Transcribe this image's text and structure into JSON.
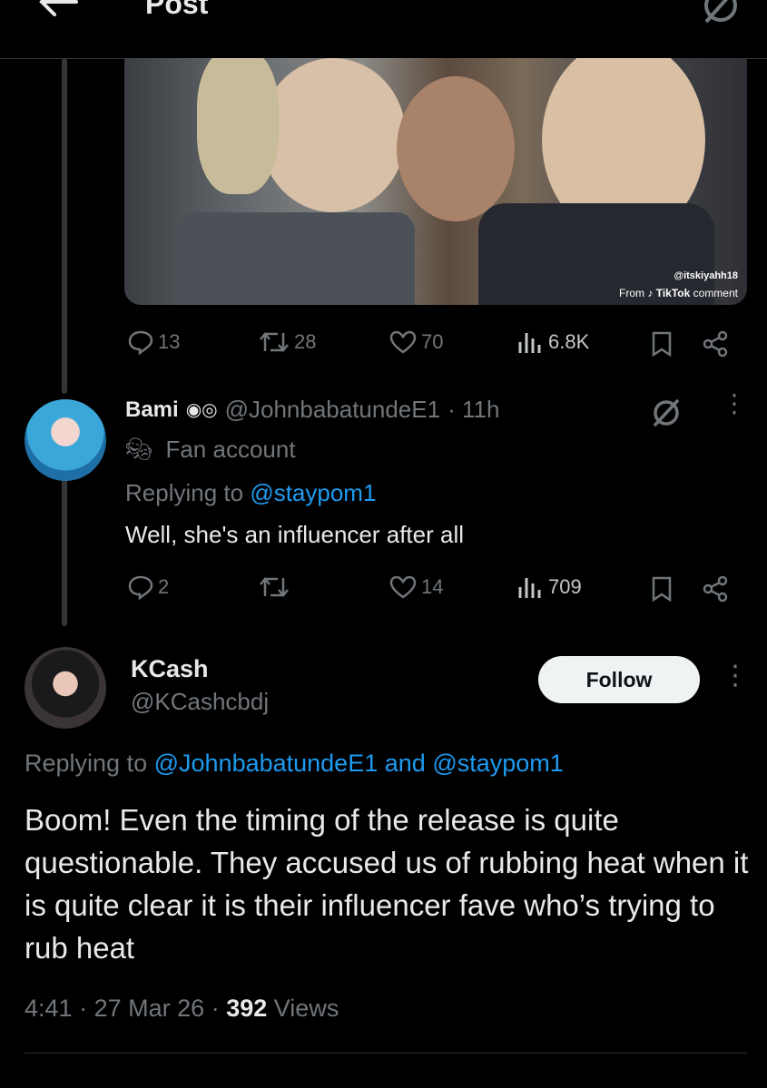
{
  "header": {
    "title": "Post",
    "back_icon": "arrow-left-icon",
    "right_icon": "grok-icon"
  },
  "media": {
    "watermark_handle": "@itskiyahh18",
    "watermark_from": "From",
    "watermark_source": "TikTok",
    "watermark_suffix": "comment"
  },
  "tweet1_actions": {
    "replies": "13",
    "reposts": "28",
    "likes": "70",
    "views": "6.8K"
  },
  "reply1": {
    "name": "Bami",
    "handle": "@JohnbabatundeE1",
    "time": "· 11h",
    "label": "Fan account",
    "replying_prefix": "Replying to",
    "replying_to": "@staypom1",
    "text": "Well, she's an influencer after all",
    "actions": {
      "replies": "2",
      "reposts": "",
      "likes": "14",
      "views": "709"
    }
  },
  "main_post": {
    "name": "KCash",
    "handle": "@KCashcbdj",
    "follow_label": "Follow",
    "replying_prefix": "Replying to",
    "replying_to_1": "@JohnbabatundeE1",
    "replying_and": "and",
    "replying_to_2": "@staypom1",
    "text": "Boom! Even the timing of the release is quite questionable. They accused us of rubbing heat when it is quite clear it is their influencer fave who’s trying to rub heat",
    "time": "4:41",
    "date": "27 Mar 26",
    "views_count": "392",
    "views_label": "Views"
  },
  "colors": {
    "accent": "#1d9bf0",
    "muted": "#71767b",
    "text": "#e7e9ea",
    "background": "#000000"
  }
}
